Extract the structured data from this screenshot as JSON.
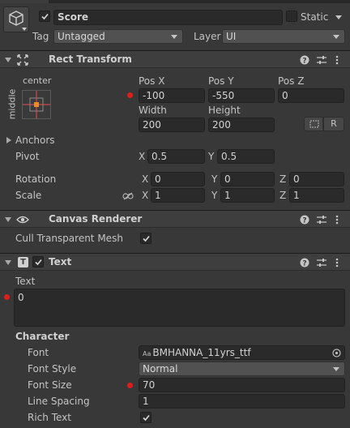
{
  "object": {
    "active_checked": true,
    "name": "Score",
    "static_label": "Static",
    "static_checked": false,
    "tag_label": "Tag",
    "tag_value": "Untagged",
    "layer_label": "Layer",
    "layer_value": "UI"
  },
  "rect_transform": {
    "title": "Rect Transform",
    "anchor_preset_top": "center",
    "anchor_preset_side": "middle",
    "pos_x_label": "Pos X",
    "pos_y_label": "Pos Y",
    "pos_z_label": "Pos Z",
    "pos_x": "-100",
    "pos_y": "-550",
    "pos_z": "0",
    "width_label": "Width",
    "height_label": "Height",
    "width": "200",
    "height": "200",
    "r_button": "R",
    "anchors_label": "Anchors",
    "pivot_label": "Pivot",
    "pivot_x_label": "X",
    "pivot_x": "0.5",
    "pivot_y_label": "Y",
    "pivot_y": "0.5",
    "rotation_label": "Rotation",
    "rot_x_label": "X",
    "rot_x": "0",
    "rot_y_label": "Y",
    "rot_y": "0",
    "rot_z_label": "Z",
    "rot_z": "0",
    "scale_label": "Scale",
    "scale_x_label": "X",
    "scale_x": "1",
    "scale_y_label": "Y",
    "scale_y": "1",
    "scale_z_label": "Z",
    "scale_z": "1"
  },
  "canvas_renderer": {
    "title": "Canvas Renderer",
    "cull_label": "Cull Transparent Mesh",
    "cull_checked": true
  },
  "text_component": {
    "title": "Text",
    "enabled": true,
    "text_label": "Text",
    "text_value": "0",
    "character_label": "Character",
    "font_label": "Font",
    "font_prefix": "Aa",
    "font_value": "BMHANNA_11yrs_ttf",
    "font_style_label": "Font Style",
    "font_style_value": "Normal",
    "font_size_label": "Font Size",
    "font_size_value": "70",
    "line_spacing_label": "Line Spacing",
    "line_spacing_value": "1",
    "rich_text_label": "Rich Text",
    "rich_text_checked": true
  },
  "colors": {
    "background": "#383838",
    "field": "#2a2a2a",
    "override_dot": "#e01d1d",
    "anchor_orange": "#e88a2a"
  }
}
